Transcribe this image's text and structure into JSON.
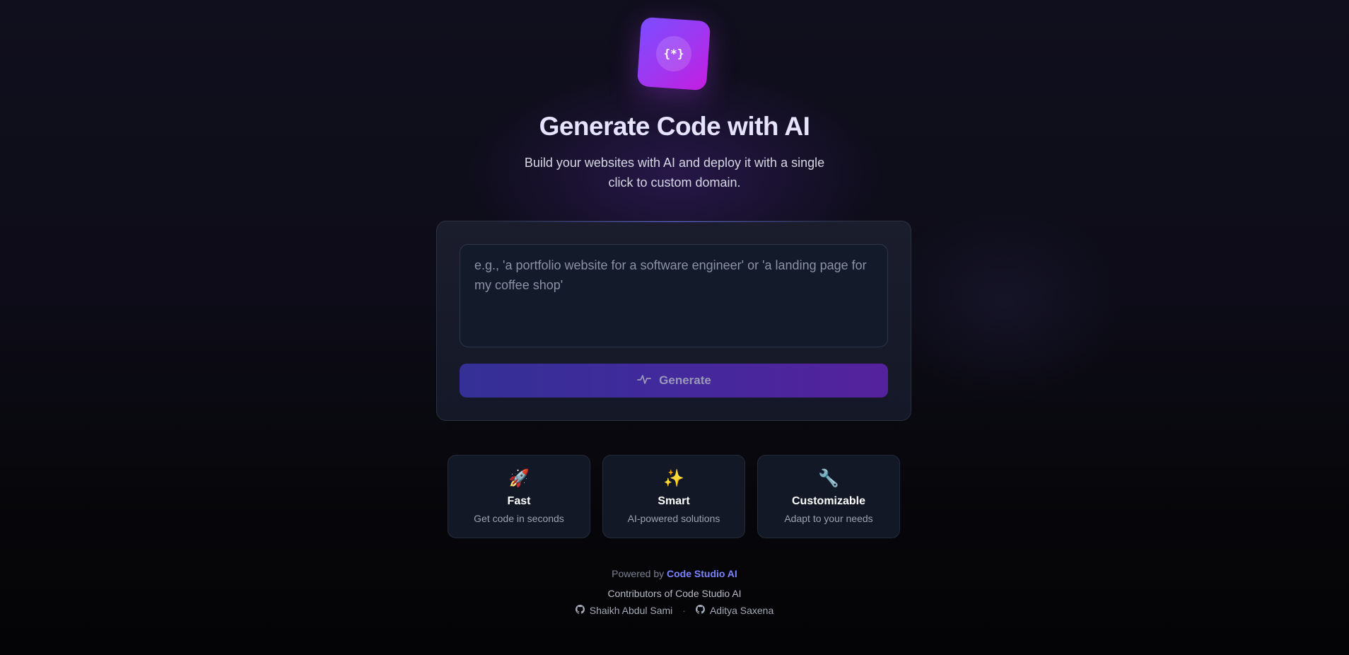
{
  "logo": {
    "icon": "code-brackets-icon",
    "glyph": "{*}",
    "colors": [
      "#7b4dff",
      "#c41ddf"
    ]
  },
  "hero": {
    "title": "Generate Code with AI",
    "subtitle": "Build your websites with AI and deploy it with a single click to custom domain."
  },
  "prompt": {
    "value": "",
    "placeholder": "e.g., 'a portfolio website for a software engineer' or 'a landing page for my coffee shop'"
  },
  "generate": {
    "label": "Generate",
    "icon": "sparkle-icon"
  },
  "features": [
    {
      "icon": "🚀",
      "icon_name": "rocket-icon",
      "title": "Fast",
      "desc": "Get code in seconds"
    },
    {
      "icon": "✨",
      "icon_name": "sparkles-icon",
      "title": "Smart",
      "desc": "AI-powered solutions"
    },
    {
      "icon": "🔧",
      "icon_name": "wrench-icon",
      "title": "Customizable",
      "desc": "Adapt to your needs"
    }
  ],
  "footer": {
    "powered_prefix": "Powered by",
    "powered_brand": "Code Studio AI",
    "contributors_title": "Contributors of Code Studio AI",
    "separator": "·",
    "contributors": [
      {
        "name": "Shaikh Abdul Sami",
        "icon": "github-icon"
      },
      {
        "name": "Aditya Saxena",
        "icon": "github-icon"
      }
    ]
  },
  "colors": {
    "accent": "#7c83ff",
    "button_start": "#343096",
    "button_end": "#55229d"
  }
}
